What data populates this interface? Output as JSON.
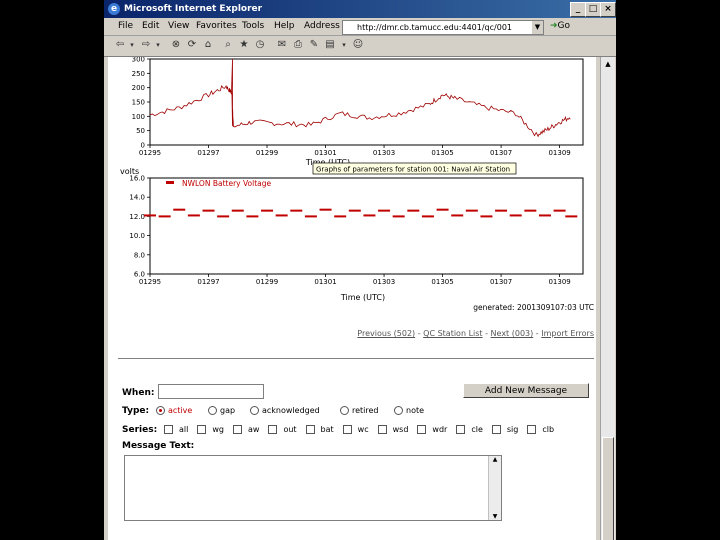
{
  "window": {
    "title": "Microsoft Internet Explorer",
    "controls": [
      "_",
      "□",
      "×"
    ]
  },
  "menu": [
    "File",
    "Edit",
    "View",
    "Favorites",
    "Tools",
    "Help"
  ],
  "address": {
    "label": "Address",
    "url": "http://dmr.cb.tamucc.edu:4401/qc/001",
    "go": "Go"
  },
  "charts": {
    "upper": {
      "y_ticks": [
        "300",
        "250",
        "200",
        "150",
        "100",
        "50",
        "0"
      ],
      "x_ticks": [
        "01295",
        "01297",
        "01299",
        "01301",
        "01303",
        "01305",
        "01307",
        "01309"
      ],
      "xlabel": "Time (UTC)",
      "tooltip": "Graphs of parameters for station 001: Naval Air Station"
    },
    "lower": {
      "ylabel": "volts",
      "legend": "NWLON Battery Voltage",
      "y_ticks": [
        "16.0",
        "14.0",
        "12.0",
        "10.0",
        "8.0",
        "6.0"
      ],
      "x_ticks": [
        "01295",
        "01297",
        "01299",
        "01301",
        "01303",
        "01305",
        "01307",
        "01309"
      ],
      "xlabel": "Time (UTC)",
      "generated": "generated: 2001309107:03 UTC"
    }
  },
  "chart_data": [
    {
      "type": "line",
      "x": [
        1295,
        1296,
        1297,
        1297.6,
        1297.8,
        1297.85,
        1298.5,
        1299.5,
        1300.5,
        1301.5,
        1302.5,
        1303.5,
        1304.5,
        1305.0,
        1305.5,
        1306.5,
        1307.5,
        1308.2,
        1308.6,
        1309.0,
        1309.4
      ],
      "y": [
        105,
        130,
        175,
        205,
        180,
        65,
        80,
        75,
        70,
        110,
        95,
        110,
        140,
        175,
        160,
        130,
        110,
        35,
        55,
        80,
        100
      ],
      "ylim": [
        0,
        300
      ],
      "xlim": [
        1295,
        1309.8
      ],
      "xlabel": "Time (UTC)"
    },
    {
      "type": "line",
      "series": [
        {
          "name": "NWLON Battery Voltage"
        }
      ],
      "x": [
        1295,
        1295.5,
        1296,
        1296.5,
        1297,
        1297.5,
        1298,
        1298.5,
        1299,
        1299.5,
        1300,
        1300.5,
        1301,
        1301.5,
        1302,
        1302.5,
        1303,
        1303.5,
        1304,
        1304.5,
        1305,
        1305.5,
        1306,
        1306.5,
        1307,
        1307.5,
        1308,
        1308.5,
        1309,
        1309.4
      ],
      "y": [
        12.1,
        12.0,
        12.7,
        12.1,
        12.6,
        12.0,
        12.6,
        12.0,
        12.6,
        12.1,
        12.6,
        12.0,
        12.7,
        12.0,
        12.6,
        12.1,
        12.6,
        12.0,
        12.6,
        12.0,
        12.7,
        12.1,
        12.6,
        12.0,
        12.6,
        12.1,
        12.6,
        12.1,
        12.6,
        12.0
      ],
      "ylim": [
        6,
        16
      ],
      "xlim": [
        1295,
        1309.8
      ],
      "ylabel": "volts",
      "xlabel": "Time (UTC)"
    }
  ],
  "nav": {
    "previous": "Previous (502)",
    "qc_list": "QC Station List",
    "next": "Next (003)",
    "errors": "Import Errors",
    "sep": "-"
  },
  "form": {
    "when_label": "When:",
    "when_value": "",
    "add_button": "Add New Message",
    "type_label": "Type:",
    "types": [
      "active",
      "gap",
      "acknowledged",
      "retired",
      "note"
    ],
    "selected_type": "active",
    "series_label": "Series:",
    "series": [
      "all",
      "wg",
      "aw",
      "out",
      "bat",
      "wc",
      "wsd",
      "wdr",
      "cle",
      "sig",
      "clb"
    ],
    "message_label": "Message Text:"
  }
}
